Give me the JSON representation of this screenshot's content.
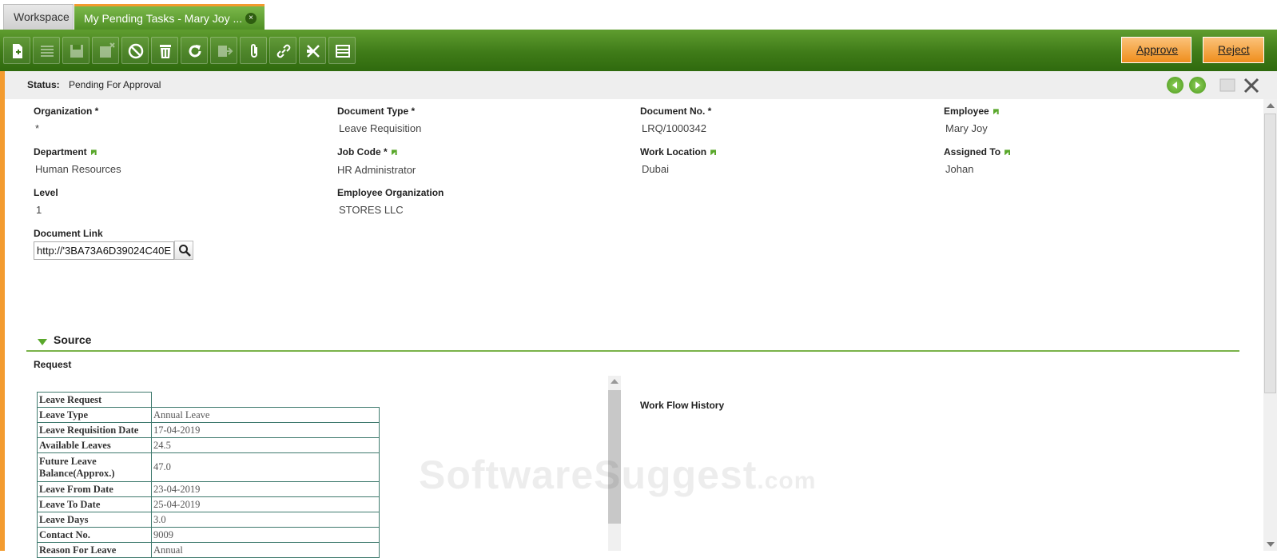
{
  "tabs": {
    "workspace": "Workspace",
    "active": "My Pending Tasks - Mary Joy ...",
    "close": "×"
  },
  "toolbar": {
    "icons": [
      "new-document-icon",
      "grid-view-icon",
      "save-icon",
      "save-close-icon",
      "cancel-icon",
      "delete-icon",
      "refresh-icon",
      "export-icon",
      "attachment-icon",
      "link-icon",
      "tools-icon",
      "form-view-icon"
    ],
    "approve_label": "Approve",
    "reject_label": "Reject",
    "accent_color": "#3f7b18",
    "button_color": "#ef8e1c"
  },
  "status": {
    "label": "Status:",
    "value": "Pending For Approval"
  },
  "form": {
    "organization": {
      "label": "Organization *",
      "value": "*"
    },
    "document_type": {
      "label": "Document Type *",
      "value": "Leave Requisition"
    },
    "document_no": {
      "label": "Document No. *",
      "value": "LRQ/1000342"
    },
    "employee": {
      "label": "Employee",
      "value": "Mary Joy"
    },
    "department": {
      "label": "Department",
      "value": "Human Resources"
    },
    "job_code": {
      "label": "Job Code *",
      "value": "HR Administrator"
    },
    "work_location": {
      "label": "Work Location",
      "value": "Dubai"
    },
    "assigned_to": {
      "label": "Assigned To",
      "value": "Johan"
    },
    "level": {
      "label": "Level",
      "value": "1"
    },
    "employee_organization": {
      "label": "Employee Organization",
      "value": "STORES LLC"
    },
    "document_link": {
      "label": "Document Link",
      "value": "http://'3BA73A6D39024C40E"
    }
  },
  "source": {
    "title": "Source",
    "request_label": "Request",
    "workflow_label": "Work Flow History",
    "table_title": "Leave Request",
    "rows": [
      {
        "key": "Leave Type",
        "value": "Annual Leave"
      },
      {
        "key": "Leave Requisition Date",
        "value": "17-04-2019"
      },
      {
        "key": "Available Leaves",
        "value": "24.5"
      },
      {
        "key": "Future Leave Balance(Approx.)",
        "value": "47.0"
      },
      {
        "key": "Leave From Date",
        "value": "23-04-2019"
      },
      {
        "key": "Leave To Date",
        "value": "25-04-2019"
      },
      {
        "key": "Leave Days",
        "value": "3.0"
      },
      {
        "key": "Contact No.",
        "value": "9009"
      },
      {
        "key": "Reason For Leave",
        "value": "Annual"
      }
    ]
  },
  "watermark": {
    "main": "SoftwareSuggest",
    "suffix": ".com"
  }
}
